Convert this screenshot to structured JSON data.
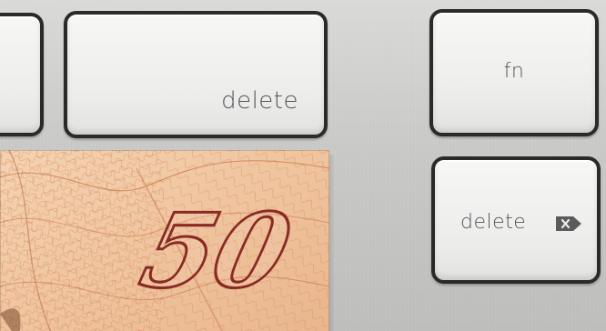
{
  "keys": {
    "delete_large_label": "delete",
    "fn_label": "fn",
    "delete_small_label": "delete"
  },
  "banknote": {
    "denomination": "50"
  },
  "colors": {
    "key_face": "#ececeb",
    "key_border": "#2a2a2a",
    "key_text": "#555658",
    "note_base": "#efc9a6",
    "note_ink": "#8a2a24"
  }
}
